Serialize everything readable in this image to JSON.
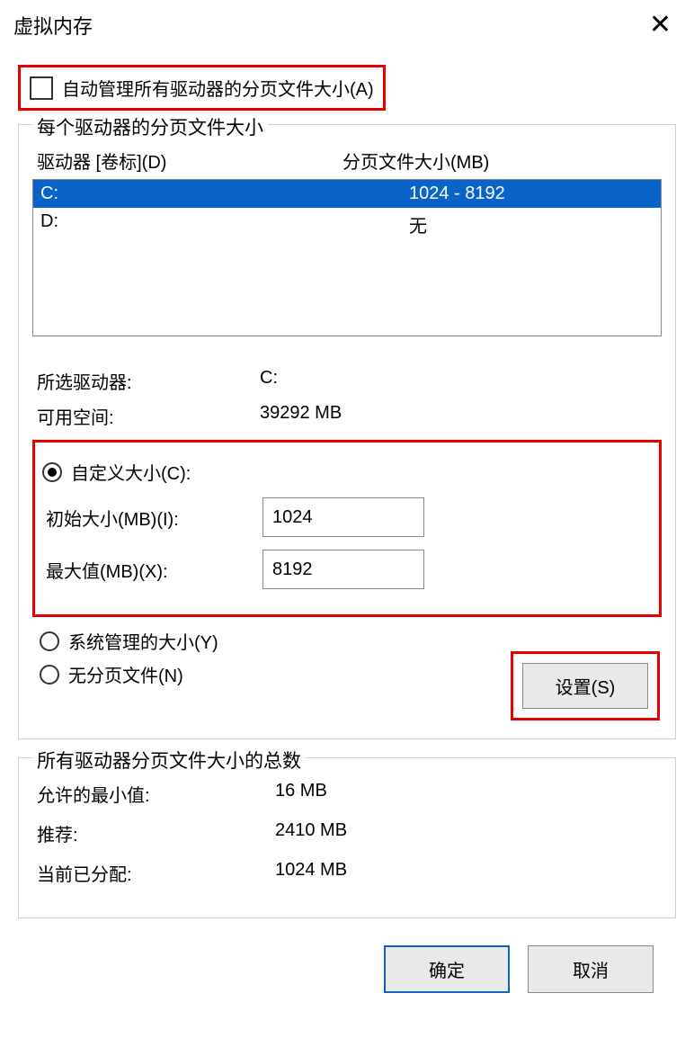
{
  "title": "虚拟内存",
  "auto_manage_label": "自动管理所有驱动器的分页文件大小(A)",
  "per_drive": {
    "legend": "每个驱动器的分页文件大小",
    "col_drive": "驱动器 [卷标](D)",
    "col_size": "分页文件大小(MB)",
    "rows": [
      {
        "drive": "C:",
        "size": "1024 - 8192",
        "selected": true
      },
      {
        "drive": "D:",
        "size": "无",
        "selected": false
      }
    ],
    "selected_drive_label": "所选驱动器:",
    "selected_drive_value": "C:",
    "free_space_label": "可用空间:",
    "free_space_value": "39292 MB",
    "custom_label": "自定义大小(C):",
    "initial_label": "初始大小(MB)(I):",
    "initial_value": "1024",
    "max_label": "最大值(MB)(X):",
    "max_value": "8192",
    "system_managed_label": "系统管理的大小(Y)",
    "no_paging_label": "无分页文件(N)",
    "set_button": "设置(S)"
  },
  "totals": {
    "legend": "所有驱动器分页文件大小的总数",
    "min_label": "允许的最小值:",
    "min_value": "16 MB",
    "rec_label": "推荐:",
    "rec_value": "2410 MB",
    "cur_label": "当前已分配:",
    "cur_value": "1024 MB"
  },
  "buttons": {
    "ok": "确定",
    "cancel": "取消"
  }
}
